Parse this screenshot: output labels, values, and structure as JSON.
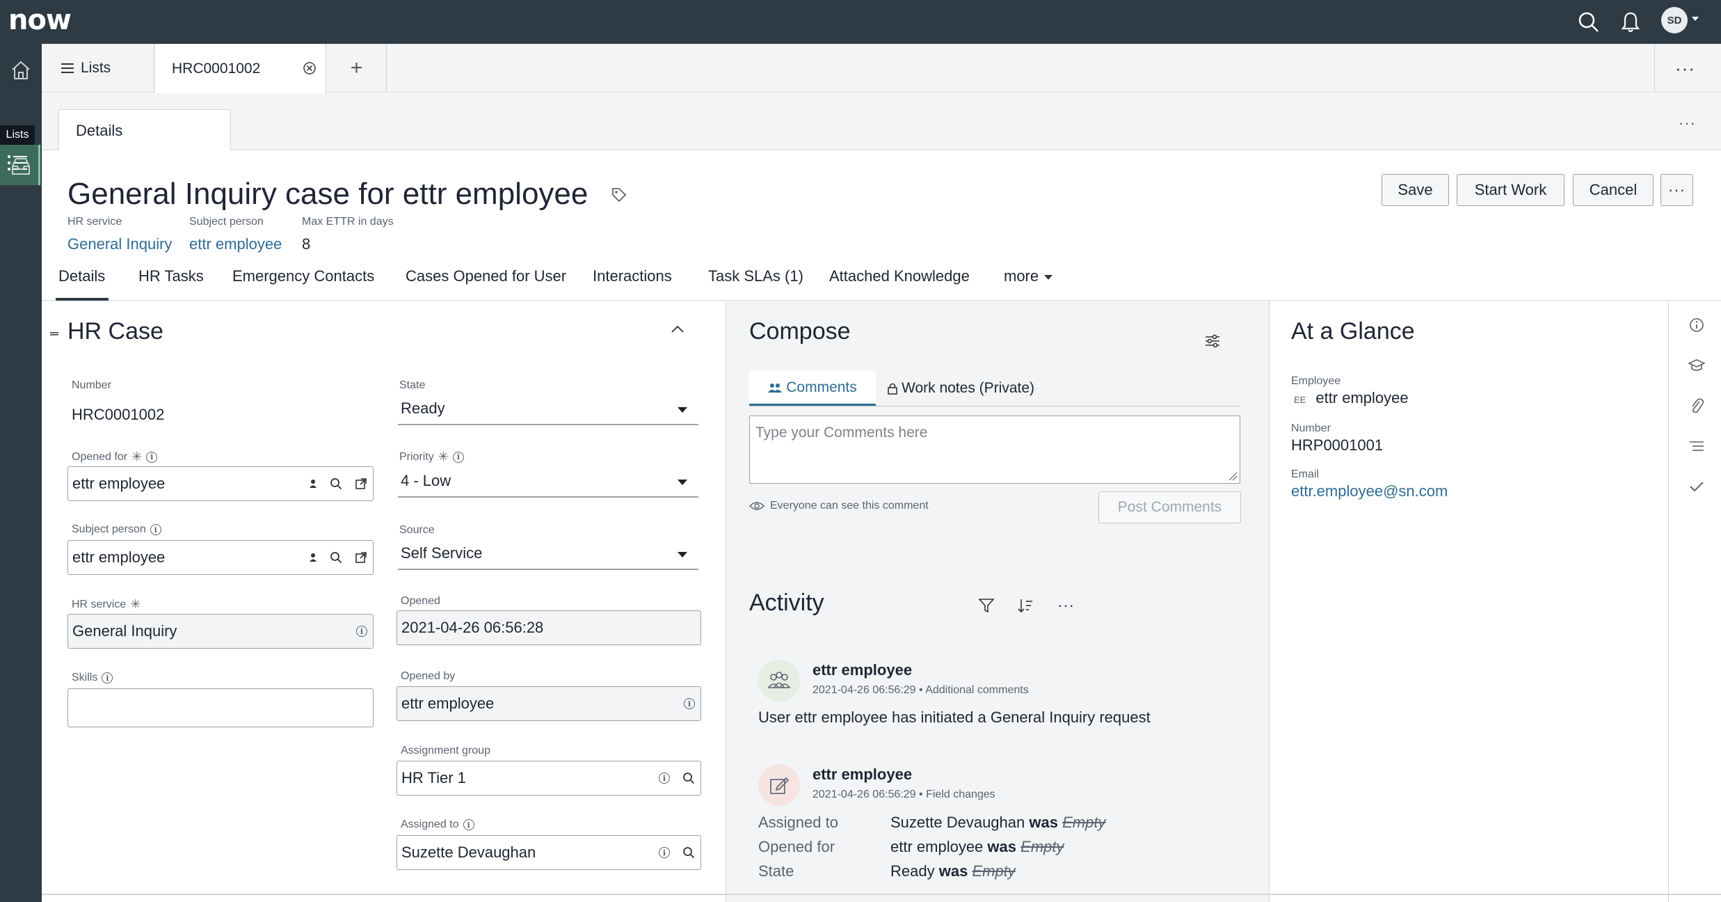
{
  "app": {
    "logo_text": "now",
    "user_initials": "SD"
  },
  "rail": {
    "tooltip": "Lists"
  },
  "tabs": {
    "lists_label": "Lists",
    "record_label": "HRC0001002",
    "add_label": "+",
    "more_label": "···"
  },
  "subtabs": {
    "details_label": "Details",
    "more_label": "···"
  },
  "header": {
    "title": "General Inquiry case for ettr employee",
    "meta": [
      {
        "label": "HR service",
        "value": "General Inquiry"
      },
      {
        "label": "Subject person",
        "value": "ettr employee"
      },
      {
        "label": "Max ETTR in days",
        "value": "8"
      }
    ],
    "buttons": {
      "save": "Save",
      "start_work": "Start Work",
      "cancel": "Cancel",
      "more": "···"
    }
  },
  "form_tabs": [
    "Details",
    "HR Tasks",
    "Emergency Contacts",
    "Cases Opened for User",
    "Interactions",
    "Task SLAs (1)",
    "Attached Knowledge",
    "more"
  ],
  "hr_case": {
    "title": "HR Case",
    "number": {
      "label": "Number",
      "value": "HRC0001002"
    },
    "opened_for": {
      "label": "Opened for",
      "value": "ettr employee"
    },
    "subject_person": {
      "label": "Subject person",
      "value": "ettr employee"
    },
    "hr_service": {
      "label": "HR service",
      "value": "General Inquiry"
    },
    "skills": {
      "label": "Skills",
      "value": ""
    },
    "state": {
      "label": "State",
      "value": "Ready"
    },
    "priority": {
      "label": "Priority",
      "value": "4 - Low"
    },
    "source": {
      "label": "Source",
      "value": "Self Service"
    },
    "opened": {
      "label": "Opened",
      "value": "2021-04-26 06:56:28"
    },
    "opened_by": {
      "label": "Opened by",
      "value": "ettr employee"
    },
    "assignment_group": {
      "label": "Assignment group",
      "value": "HR Tier 1"
    },
    "assigned_to": {
      "label": "Assigned to",
      "value": "Suzette Devaughan"
    }
  },
  "compose": {
    "title": "Compose",
    "tab_comments": "Comments",
    "tab_worknotes": "Work notes (Private)",
    "placeholder": "Type your Comments here",
    "visibility": "Everyone can see this comment",
    "post_button": "Post Comments"
  },
  "activity": {
    "title": "Activity",
    "entries": [
      {
        "name": "ettr employee",
        "meta": "2021-04-26 06:56:29 • Additional comments",
        "text": "User ettr employee has initiated a General Inquiry request"
      },
      {
        "name": "ettr employee",
        "meta": "2021-04-26 06:56:29 • Field changes",
        "changes": [
          {
            "field": "Assigned to",
            "value": "Suzette Devaughan",
            "was": "was",
            "old": "Empty"
          },
          {
            "field": "Opened for",
            "value": "ettr employee",
            "was": "was",
            "old": "Empty"
          },
          {
            "field": "State",
            "value": "Ready",
            "was": "was",
            "old": "Empty"
          }
        ]
      }
    ]
  },
  "glance": {
    "title": "At a Glance",
    "employee_label": "Employee",
    "employee_initials": "EE",
    "employee_value": "ettr employee",
    "number_label": "Number",
    "number_value": "HRP0001001",
    "email_label": "Email",
    "email_value": "ettr.employee@sn.com"
  },
  "colors": {
    "topbar": "#2e3a44",
    "link": "#2f6d94",
    "rail_active": "#3d6d5a"
  }
}
